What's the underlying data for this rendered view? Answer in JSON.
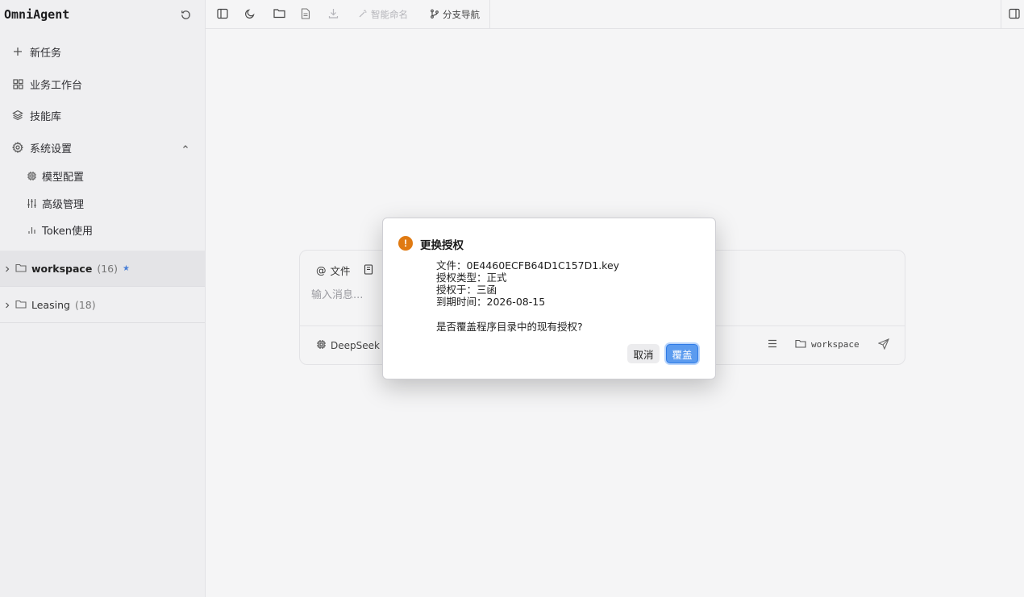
{
  "sidebar": {
    "app_title": "OmniAgent",
    "nav": {
      "new_task": "新任务",
      "workbench": "业务工作台",
      "skills": "技能库",
      "settings": "系统设置"
    },
    "settings_sub": {
      "model_config": "模型配置",
      "advanced": "高级管理",
      "token_usage": "Token使用"
    },
    "folders": [
      {
        "name": "workspace",
        "count": "(16)",
        "starred": true
      },
      {
        "name": "Leasing",
        "count": "(18)",
        "starred": false
      }
    ]
  },
  "toolbar": {
    "smart_name": "智能命名",
    "branch_nav": "分支导航"
  },
  "composer": {
    "tab_file": "文件",
    "placeholder": "输入消息...",
    "model": "DeepSeek V",
    "workspace": "workspace"
  },
  "dialog": {
    "title": "更换授权",
    "icon": "!",
    "file_line": "文件：0E4460ECFB64D1C157D1.key",
    "type_line": "授权类型：正式",
    "grantee_line": "授权于：三函",
    "expiry_line": "到期时间：2026-08-15",
    "question": "是否覆盖程序目录中的现有授权?",
    "cancel": "取消",
    "confirm": "覆盖"
  },
  "colors": {
    "accent": "#5b9bef",
    "warning": "#e07a12",
    "star": "#4a7fd6"
  }
}
